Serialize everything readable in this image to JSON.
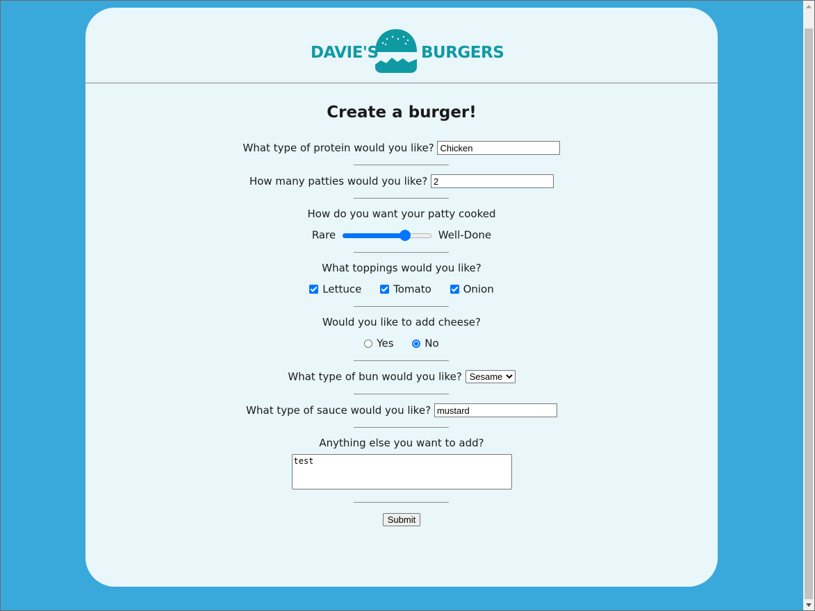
{
  "brand": {
    "left": "DAVIE'S",
    "right": "BURGERS",
    "color": "#0f9aa3"
  },
  "colors": {
    "page_bg": "#39a8db",
    "card_bg": "#e9f6fa",
    "accent": "#0075ff"
  },
  "form": {
    "title": "Create a burger!",
    "protein": {
      "label": "What type of protein would you like?",
      "value": "Chicken"
    },
    "patties": {
      "label": "How many patties would you like?",
      "value": "2"
    },
    "cook": {
      "label": "How do you want your patty cooked",
      "min_label": "Rare",
      "max_label": "Well-Done",
      "value_fraction": 0.73
    },
    "toppings": {
      "label": "What toppings would you like?",
      "options": [
        "Lettuce",
        "Tomato",
        "Onion"
      ],
      "checked": [
        true,
        true,
        true
      ]
    },
    "cheese": {
      "label": "Would you like to add cheese?",
      "options": [
        "Yes",
        "No"
      ],
      "selected": "No"
    },
    "bun": {
      "label": "What type of bun would you like?",
      "selected": "Sesame"
    },
    "sauce": {
      "label": "What type of sauce would you like?",
      "value": "mustard"
    },
    "extra": {
      "label": "Anything else you want to add?",
      "value": "test"
    },
    "submit_label": "Submit"
  }
}
